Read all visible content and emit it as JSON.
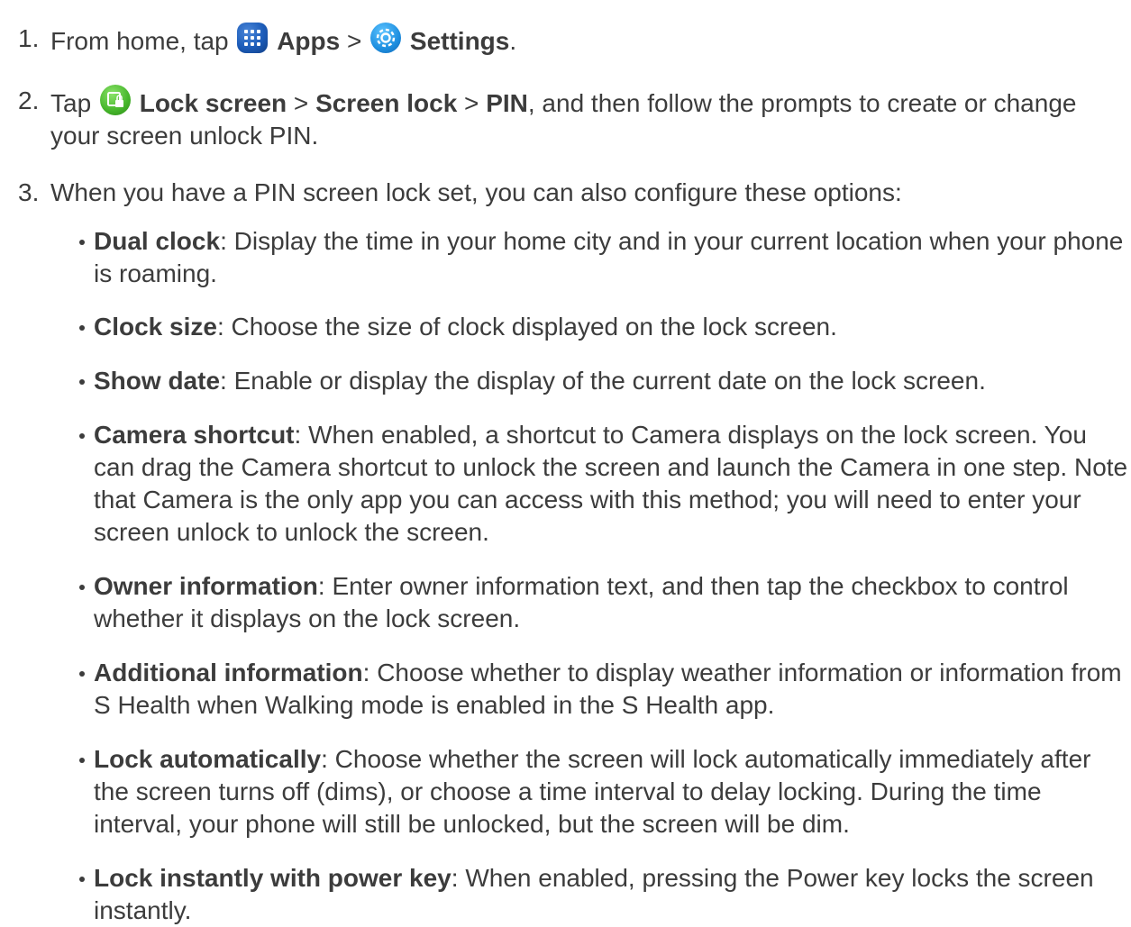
{
  "steps": [
    {
      "number": "1.",
      "prefix": "From home, tap ",
      "apps_label": "Apps",
      "separator": " > ",
      "settings_label": "Settings",
      "suffix": "."
    },
    {
      "number": "2.",
      "prefix": "Tap ",
      "lock_screen_label": "Lock screen",
      "separator1": " > ",
      "screen_lock_label": "Screen lock",
      "separator2": " > ",
      "pin_label": "PIN",
      "suffix": ", and then follow the prompts to create or change your screen unlock PIN."
    },
    {
      "number": "3.",
      "text": "When you have a PIN screen lock set, you can also configure these options:"
    }
  ],
  "options": [
    {
      "term": "Dual clock",
      "description": ": Display the time in your home city and in your current location when your phone is roaming."
    },
    {
      "term": "Clock size",
      "description": ": Choose the size of clock displayed on the lock screen."
    },
    {
      "term": "Show date",
      "description": ": Enable or display the display of the current date on the lock screen."
    },
    {
      "term": "Camera shortcut",
      "description": ": When enabled, a shortcut to Camera displays on the lock screen. You can drag the Camera shortcut to unlock the screen and launch the Camera in one step. Note that Camera is the only app you can access with this method; you will need to enter your screen unlock to unlock the screen."
    },
    {
      "term": "Owner information",
      "description": ": Enter owner information text, and then tap the checkbox to control whether it displays on the lock screen."
    },
    {
      "term": "Additional information",
      "description": ": Choose whether to display weather information or information from S Health when Walking mode is enabled in the S Health app."
    },
    {
      "term": "Lock automatically",
      "description": ": Choose whether the screen will lock automatically immediately after the screen turns off (dims), or choose a time interval to delay locking. During the time interval, your phone will still be unlocked, but the screen will be dim."
    },
    {
      "term": "Lock instantly with power key",
      "description": ": When enabled, pressing the Power key locks the screen instantly."
    }
  ],
  "icons": {
    "apps": "apps-grid-icon",
    "settings": "settings-gear-icon",
    "lock_screen": "lock-screen-icon"
  }
}
